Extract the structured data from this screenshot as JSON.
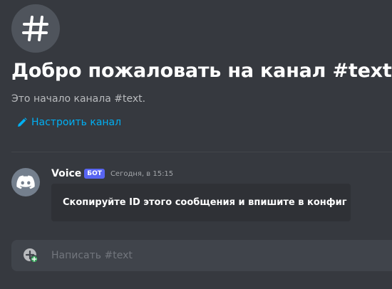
{
  "welcome": {
    "icon": "hash-icon",
    "title": "Добро пожаловать на канал #text!",
    "subtitle": "Это начало канала #text.",
    "edit_link_icon": "pencil-icon",
    "edit_link_label": "Настроить канал"
  },
  "message": {
    "avatar_icon": "discord-logo-icon",
    "author": "Voice",
    "badge": "БОТ",
    "timestamp": "Сегодня, в 15:15",
    "embed_text": "Скопируйте ID этого сообщения и впишите в конфиг"
  },
  "composer": {
    "attach_icon": "add-attachment-icon",
    "placeholder": "Написать #text"
  },
  "colors": {
    "background": "#36393f",
    "embed_background": "#2f3136",
    "link": "#00b0f4",
    "bot_badge": "#5865f2",
    "composer_background": "#40444b",
    "attach_plus_badge": "#3ba55d"
  }
}
